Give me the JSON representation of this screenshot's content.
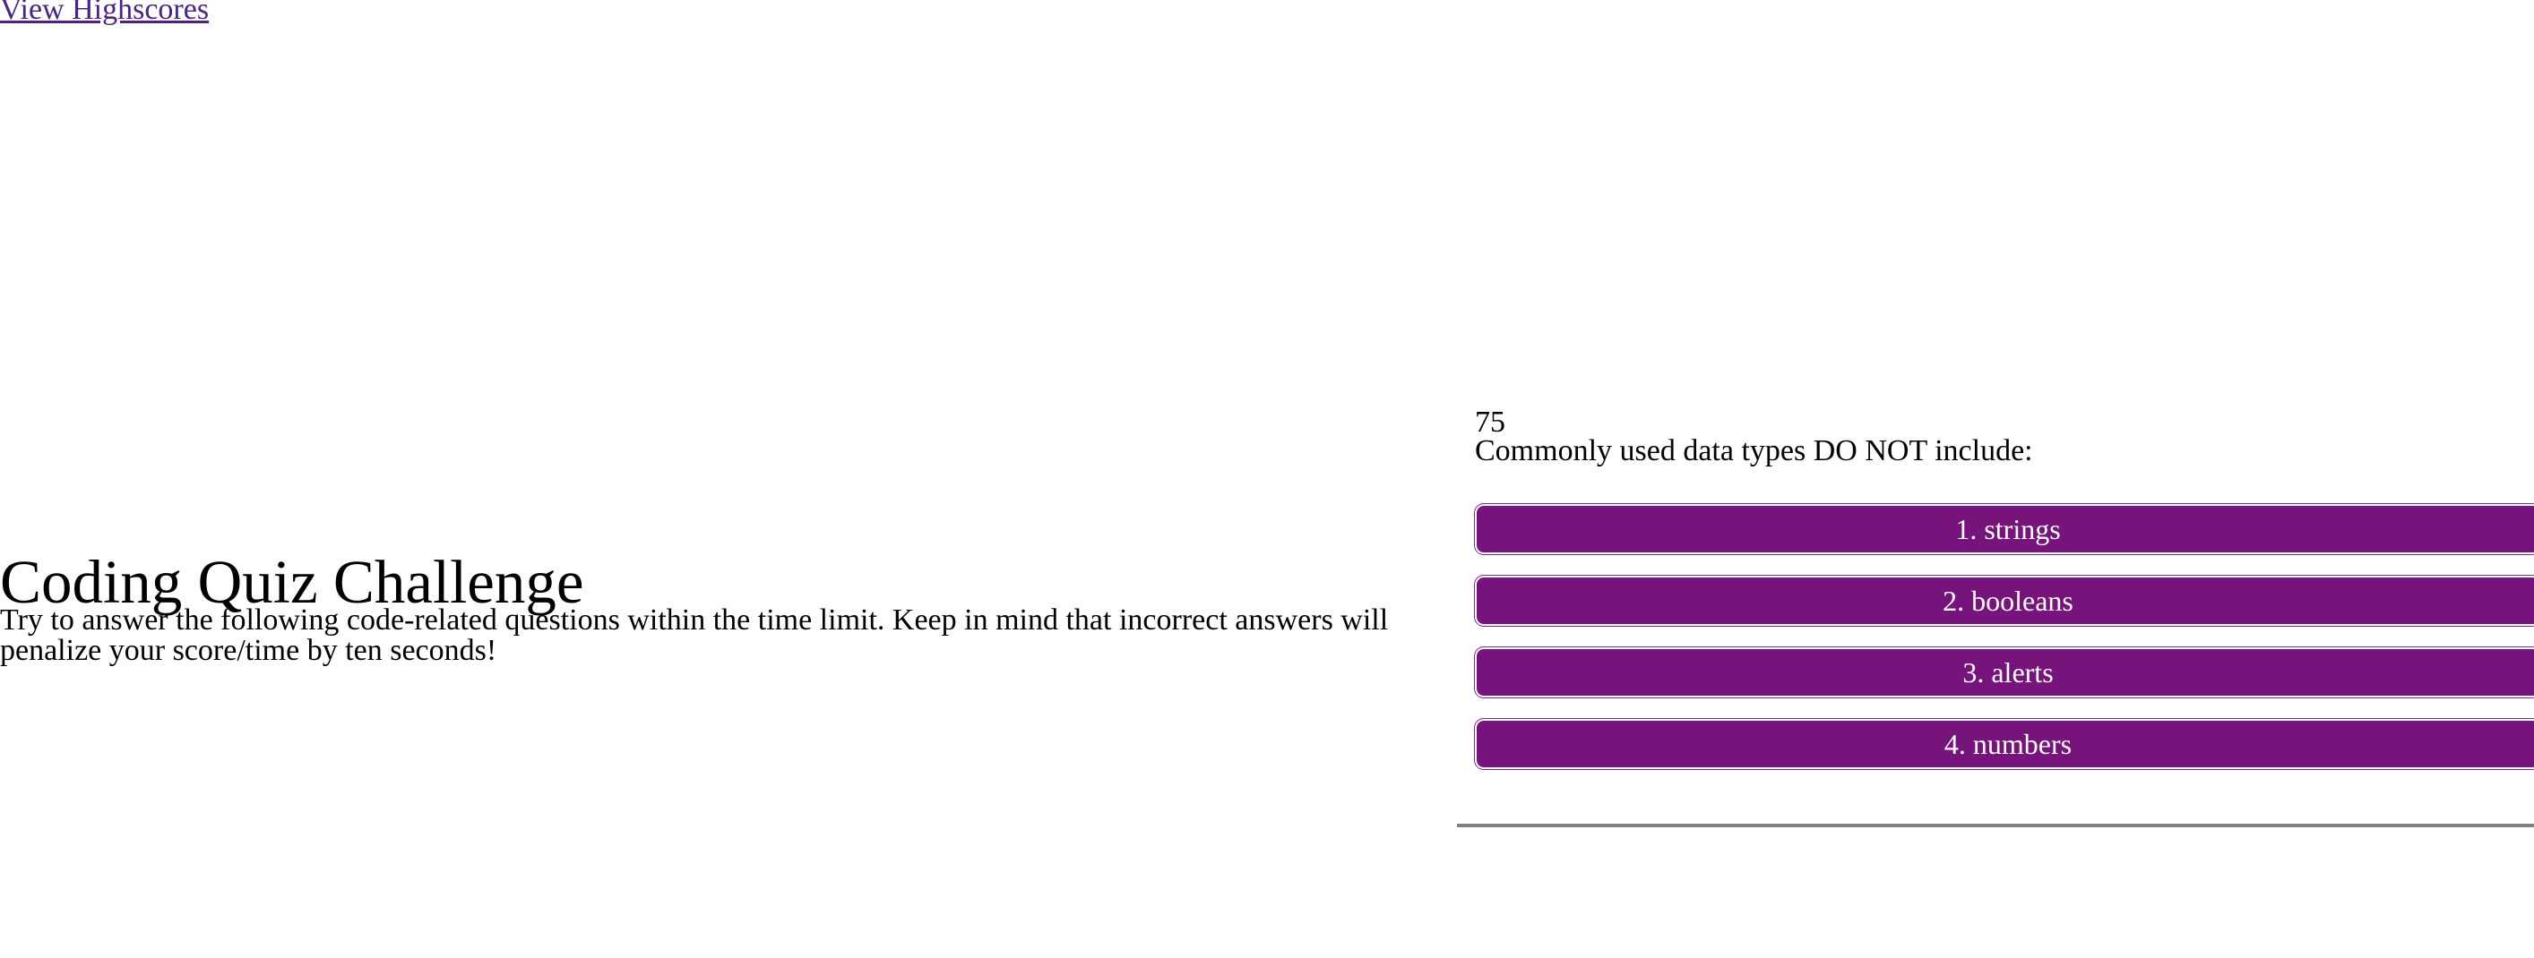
{
  "header": {
    "highscores_link": "View Highscores"
  },
  "intro": {
    "title": "Coding Quiz Challenge",
    "description": "Try to answer the following code-related questions within the time limit. Keep in mind that incorrect answers will penalize your score/time by ten seconds!"
  },
  "quiz": {
    "timer": "75",
    "question": "Commonly used data types DO NOT include:",
    "answers": [
      "1. strings",
      "2. booleans",
      "3. alerts",
      "4. numbers"
    ]
  },
  "colors": {
    "link": "#4b2384",
    "answer_button_bg": "#76147B",
    "answer_button_text": "#ffffff",
    "divider": "#808080"
  }
}
